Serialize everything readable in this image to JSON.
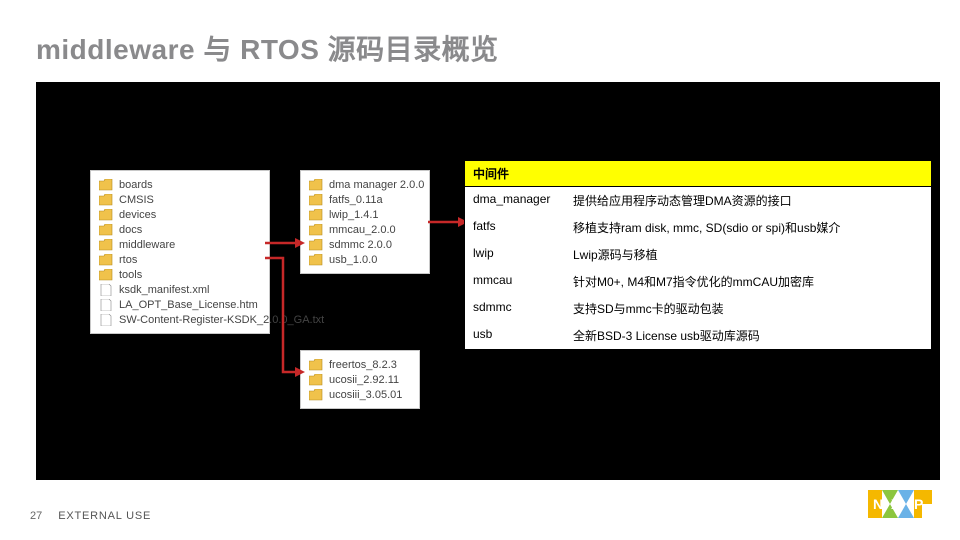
{
  "title": "middleware 与 RTOS 源码目录概览",
  "footer": {
    "page": "27",
    "marking": "EXTERNAL USE"
  },
  "main_list": [
    {
      "icon": "folder",
      "name": "boards"
    },
    {
      "icon": "folder",
      "name": "CMSIS"
    },
    {
      "icon": "folder",
      "name": "devices"
    },
    {
      "icon": "folder",
      "name": "docs"
    },
    {
      "icon": "folder",
      "name": "middleware"
    },
    {
      "icon": "folder",
      "name": "rtos"
    },
    {
      "icon": "folder",
      "name": "tools"
    },
    {
      "icon": "xml",
      "name": "ksdk_manifest.xml"
    },
    {
      "icon": "htm",
      "name": "LA_OPT_Base_License.htm"
    },
    {
      "icon": "txt",
      "name": "SW-Content-Register-KSDK_2.0.0_GA.txt"
    }
  ],
  "middleware_list": [
    {
      "icon": "folder",
      "name": "dma manager 2.0.0"
    },
    {
      "icon": "folder",
      "name": "fatfs_0.11a"
    },
    {
      "icon": "folder",
      "name": "lwip_1.4.1"
    },
    {
      "icon": "folder",
      "name": "mmcau_2.0.0"
    },
    {
      "icon": "folder",
      "name": "sdmmc 2.0.0"
    },
    {
      "icon": "folder",
      "name": "usb_1.0.0"
    }
  ],
  "rtos_list": [
    {
      "icon": "folder",
      "name": "freertos_8.2.3"
    },
    {
      "icon": "folder",
      "name": "ucosii_2.92.11"
    },
    {
      "icon": "folder",
      "name": "ucosiii_3.05.01"
    }
  ],
  "mw_table": {
    "header": "中间件",
    "rows": [
      {
        "name": "dma_manager",
        "desc": "提供给应用程序动态管理DMA资源的接口"
      },
      {
        "name": "fatfs",
        "desc": "移植支持ram disk, mmc, SD(sdio or spi)和usb媒介"
      },
      {
        "name": "lwip",
        "desc": "Lwip源码与移植"
      },
      {
        "name": "mmcau",
        "desc": "针对M0+, M4和M7指令优化的mmCAU加密库"
      },
      {
        "name": "sdmmc",
        "desc": "支持SD与mmc卡的驱动包装"
      },
      {
        "name": "usb",
        "desc": "全新BSD-3 License usb驱动库源码"
      }
    ]
  },
  "icons": {
    "folder": "folder-icon",
    "xml": "xml-file-icon",
    "htm": "htm-file-icon",
    "txt": "txt-file-icon"
  }
}
